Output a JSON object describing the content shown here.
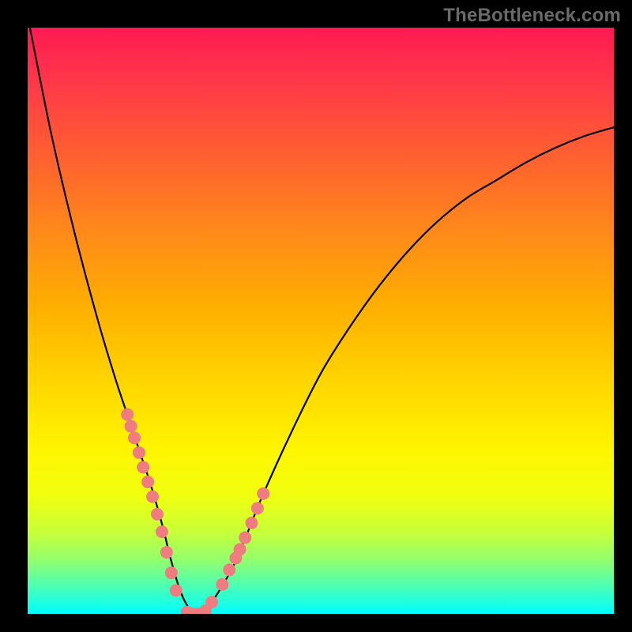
{
  "watermark": "TheBottleneck.com",
  "chart_data": {
    "type": "line",
    "title": "",
    "xlabel": "",
    "ylabel": "",
    "xlim": [
      0,
      100
    ],
    "ylim": [
      0,
      100
    ],
    "grid": false,
    "series": [
      {
        "name": "bottleneck-curve",
        "x": [
          0,
          4,
          8,
          12,
          15,
          17,
          19,
          21,
          23,
          24.5,
          26,
          27.5,
          29,
          30,
          35,
          40,
          45,
          50,
          55,
          60,
          65,
          70,
          75,
          80,
          85,
          90,
          95,
          100
        ],
        "y": [
          102,
          82,
          65,
          50,
          40,
          34,
          28,
          22,
          15,
          9,
          4,
          1,
          0,
          0,
          8,
          20,
          31,
          41,
          49,
          56,
          62,
          67,
          71,
          74,
          77,
          79.5,
          81.5,
          83
        ]
      }
    ],
    "markers": {
      "name": "highlight-points",
      "color": "#ef7d80",
      "radius_px": 8,
      "x": [
        17.0,
        17.6,
        18.2,
        19.0,
        19.7,
        20.5,
        21.3,
        22.1,
        22.9,
        23.7,
        24.5,
        25.3,
        27.2,
        28.0,
        28.9,
        29.6,
        30.3,
        31.4,
        33.2,
        34.4,
        35.5,
        36.2,
        37.1,
        38.2,
        39.2,
        40.2
      ],
      "y": [
        34.0,
        32.0,
        30.0,
        27.5,
        25.0,
        22.5,
        20.0,
        17.0,
        14.0,
        10.5,
        7.0,
        4.0,
        0.3,
        0.0,
        0.0,
        0.0,
        0.5,
        2.0,
        5.0,
        7.5,
        9.5,
        11.0,
        13.0,
        15.5,
        18.0,
        20.5
      ]
    }
  }
}
